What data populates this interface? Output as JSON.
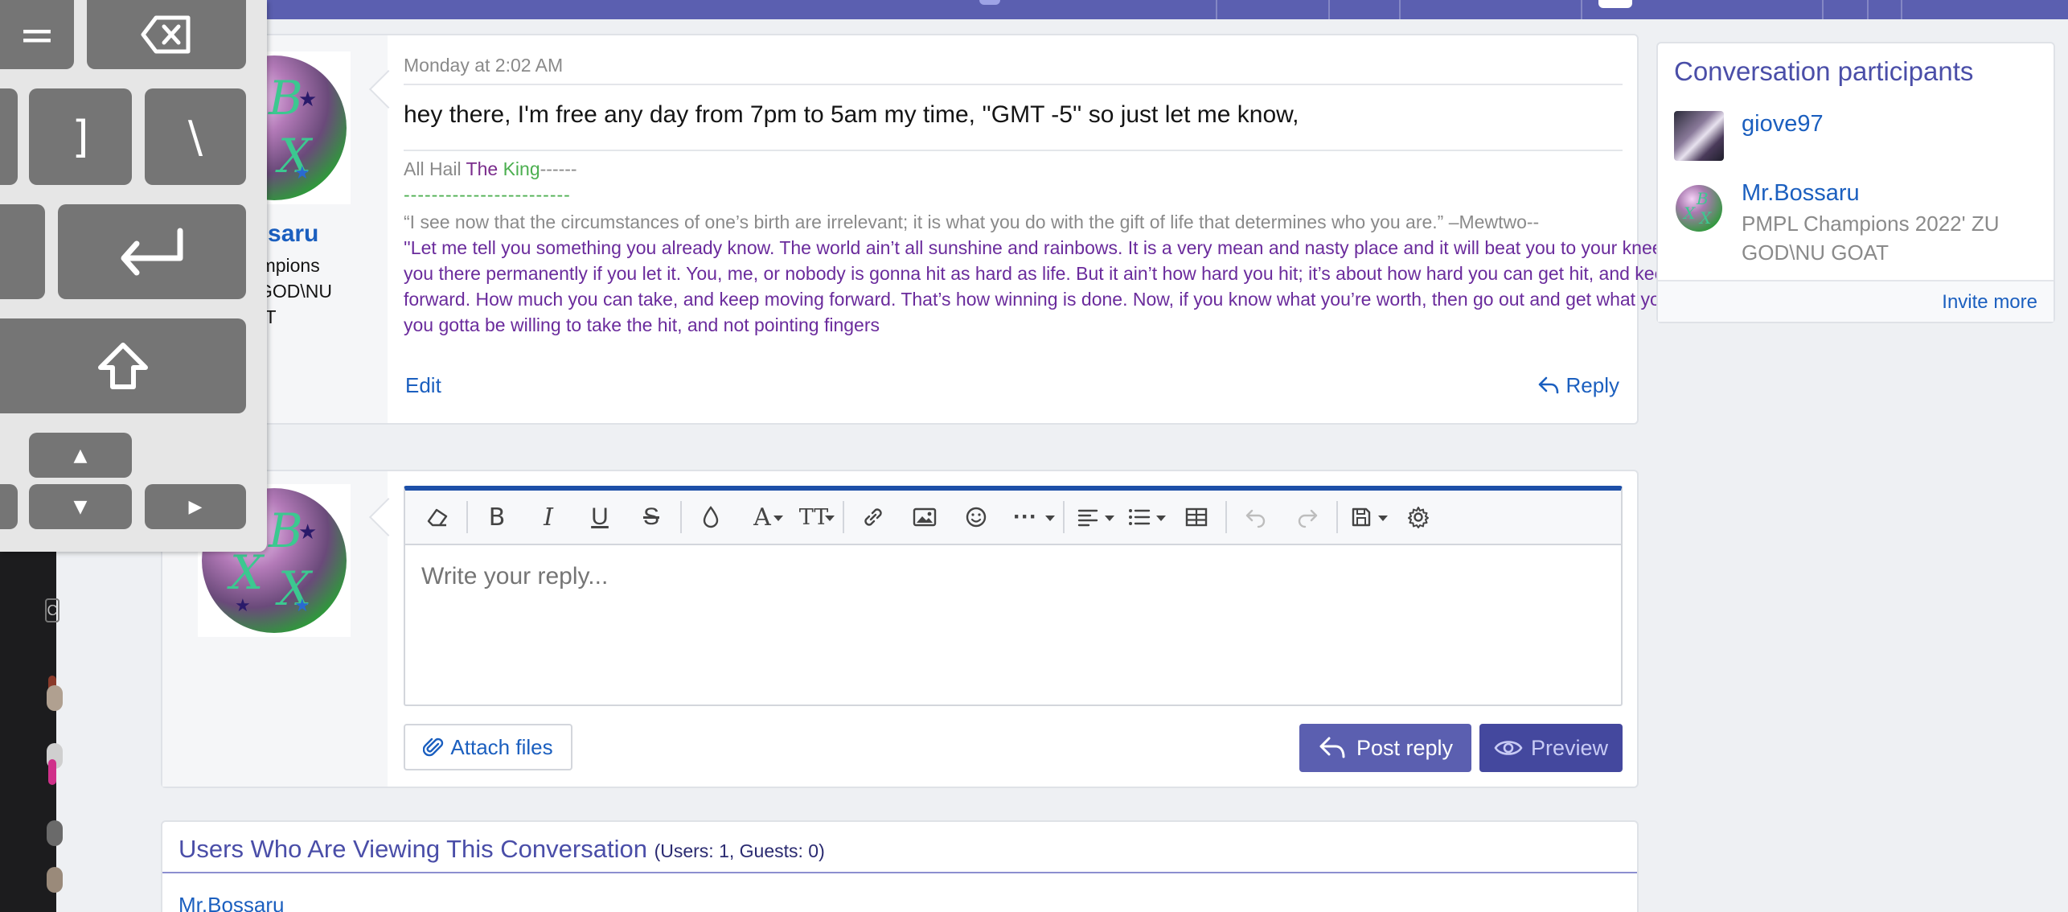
{
  "message": {
    "date": "Monday at 2:02 AM",
    "author": "Mr.Bossaru",
    "author_visible": "ossaru",
    "author_title": "PMPL Champions 2022' ZU GOD\\NU GOAT",
    "author_title_visible_1": "hampions",
    "author_title_visible_2": "U GOD\\NU",
    "author_title_visible_3": "OAT",
    "body": "hey there, I'm free any day from 7pm to 5am my time, ''GMT -5'' so just let me know,",
    "signature": {
      "hail_prefix": "All Hail ",
      "hail_the": "The",
      "hail_king": " King",
      "hail_dashes": "------",
      "dash_line": "------------------------",
      "quote1": "“I see now that the circumstances of one’s birth are irrelevant; it is what you do with the gift of life that determines who you are.” –Mewtwo--",
      "quote2": "''Let me tell you something you already know. The world ain’t all sunshine and rainbows. It is a very mean and nasty place and it will beat you to your knees and keep you there permanently if you let it. You, me, or nobody is gonna hit as hard as life. But it ain’t how hard you hit; it’s about how hard you can get hit, and keep moving forward. How much you can take, and keep moving forward. That’s how winning is done. Now, if you know what you’re worth, then go out and get what you’re worth. But you gotta be willing to take the hit, and not pointing fingers"
    },
    "edit_label": "Edit",
    "reply_label": "Reply"
  },
  "editor": {
    "placeholder": "Write your reply...",
    "toolbar": {
      "bold": "B",
      "italic": "I",
      "underline": "U",
      "strike": "S",
      "font_size": "TT",
      "more": "···",
      "font": "A"
    },
    "attach_label": "Attach files",
    "post_label": "Post reply",
    "preview_label": "Preview"
  },
  "viewing": {
    "title": "Users Who Are Viewing This Conversation",
    "counts": "(Users: 1, Guests: 0)",
    "users": [
      "Mr.Bossaru"
    ]
  },
  "participants": {
    "title": "Conversation participants",
    "list": [
      {
        "name": "giove97"
      },
      {
        "name": "Mr.Bossaru",
        "title": "PMPL Champions 2022' ZU GOD\\NU GOAT"
      }
    ],
    "invite_label": "Invite more"
  },
  "keyboard": {
    "keys": {
      "equals": "=",
      "backspace": "⌫",
      "bracket_right": "]",
      "backslash": "\\",
      "return": "↵",
      "shift": "⇧",
      "up": "▲",
      "down": "▼",
      "right": "▶"
    }
  },
  "leftstrip": {
    "box_letter": "C"
  },
  "colors": {
    "accent": "#5b5fb0",
    "link": "#1b5fbf",
    "editor_top": "#1d4fa8",
    "sig_green": "#4caf50",
    "sig_purple": "#6a2b9c"
  }
}
